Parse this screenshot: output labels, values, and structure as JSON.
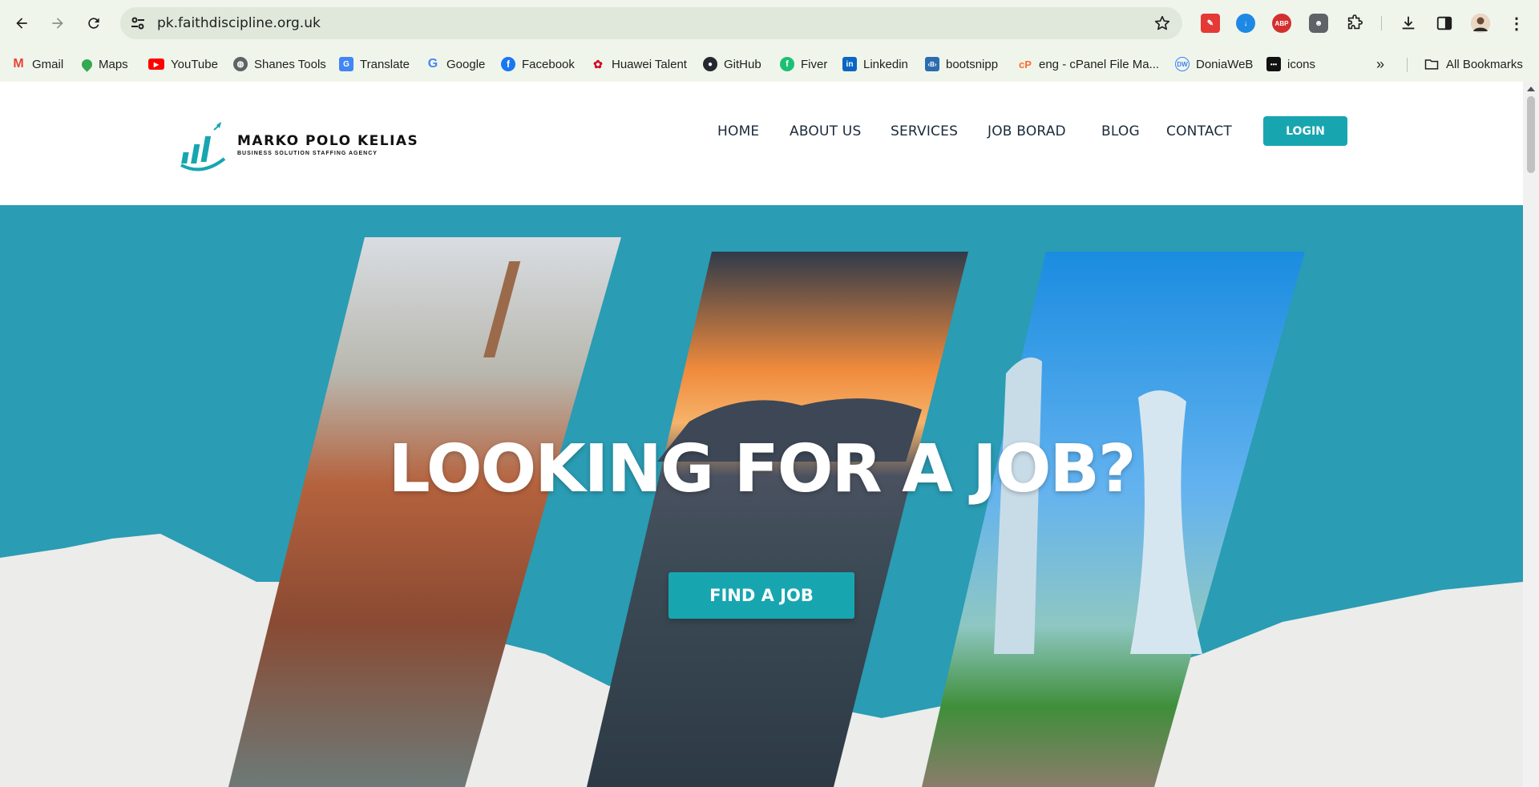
{
  "browser": {
    "url": "pk.faithdiscipline.org.uk",
    "bookmarks": [
      {
        "label": "Gmail",
        "icon": "gmail-icon",
        "color": "#ea4335"
      },
      {
        "label": "Maps",
        "icon": "maps-icon",
        "color": "#34a853"
      },
      {
        "label": "YouTube",
        "icon": "youtube-icon",
        "color": "#ff0000"
      },
      {
        "label": "Shanes Tools",
        "icon": "globe-icon",
        "color": "#5f6368"
      },
      {
        "label": "Translate",
        "icon": "translate-icon",
        "color": "#4285f4"
      },
      {
        "label": "Google",
        "icon": "google-icon",
        "color": "#4285f4"
      },
      {
        "label": "Facebook",
        "icon": "facebook-icon",
        "color": "#1877f2"
      },
      {
        "label": "Huawei Talent",
        "icon": "huawei-icon",
        "color": "#cf0a2c"
      },
      {
        "label": "GitHub",
        "icon": "github-icon",
        "color": "#24292f"
      },
      {
        "label": "Fiver",
        "icon": "fiverr-icon",
        "color": "#1dbf73"
      },
      {
        "label": "Linkedin",
        "icon": "linkedin-icon",
        "color": "#0a66c2"
      },
      {
        "label": "bootsnipp",
        "icon": "bootsnipp-icon",
        "color": "#2b6cb0"
      },
      {
        "label": "eng - cPanel File Ma...",
        "icon": "cpanel-icon",
        "color": "#ff6c2c"
      },
      {
        "label": "DoniaWeB",
        "icon": "doniaweb-icon",
        "color": "#3b82f6"
      },
      {
        "label": "icons",
        "icon": "icons-icon",
        "color": "#111111"
      }
    ],
    "all_bookmarks_label": "All Bookmarks"
  },
  "site": {
    "logo_title": "MARKO POLO KELIAS",
    "logo_subtitle": "BUSINESS SOLUTION STAFFING AGENCY",
    "nav": [
      "HOME",
      "ABOUT US",
      "SERVICES",
      "JOB BORAD",
      "BLOG",
      "CONTACT"
    ],
    "login_label": "LOGIN"
  },
  "hero": {
    "title": "LOOKING FOR A JOB?",
    "cta_label": "FIND A JOB"
  },
  "colors": {
    "accent": "#17a6b0",
    "hero_bg": "#2a9cb3",
    "browser_chrome": "#f0f5ec"
  }
}
